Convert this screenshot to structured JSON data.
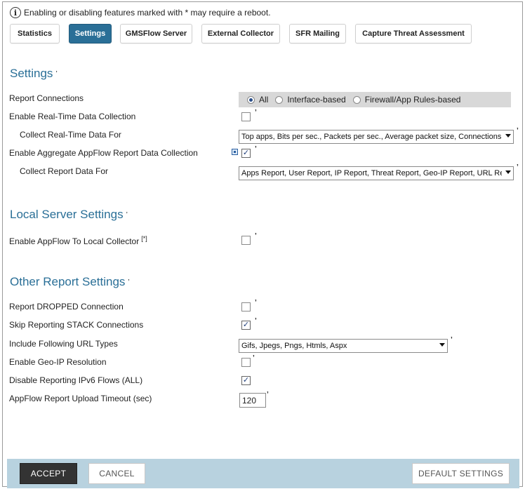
{
  "notice": {
    "icon": "info-icon",
    "text": "Enabling or disabling features marked with * may require a reboot."
  },
  "tabs": [
    {
      "label": "Statistics",
      "active": false
    },
    {
      "label": "Settings",
      "active": true
    },
    {
      "label": "GMSFlow Server",
      "active": false
    },
    {
      "label": "External Collector",
      "active": false
    },
    {
      "label": "SFR Mailing",
      "active": false
    },
    {
      "label": "Capture Threat Assessment",
      "active": false
    }
  ],
  "settings": {
    "title": "Settings",
    "report_connections": {
      "label": "Report Connections",
      "options": [
        "All",
        "Interface-based",
        "Firewall/App Rules-based"
      ],
      "selected": "All"
    },
    "realtime": {
      "label": "Enable Real-Time Data Collection",
      "checked": false
    },
    "realtime_for": {
      "label": "Collect Real-Time Data For",
      "value": "Top apps, Bits per sec., Packets per sec., Average packet size, Connections per"
    },
    "aggregate": {
      "label": "Enable Aggregate AppFlow Report Data Collection",
      "checked": true
    },
    "report_for": {
      "label": "Collect Report Data For",
      "value": "Apps Report, User Report, IP Report, Threat Report, Geo-IP Report, URL Report"
    }
  },
  "local": {
    "title": "Local Server Settings",
    "enable_local": {
      "label": "Enable AppFlow To Local Collector",
      "marker": "[*]",
      "checked": false
    }
  },
  "other": {
    "title": "Other Report Settings",
    "dropped": {
      "label": "Report DROPPED Connection",
      "checked": false
    },
    "stack": {
      "label": "Skip Reporting STACK Connections",
      "checked": true
    },
    "url_types": {
      "label": "Include Following URL Types",
      "value": "Gifs, Jpegs, Pngs, Htmls, Aspx"
    },
    "geoip": {
      "label": "Enable Geo-IP Resolution",
      "checked": false
    },
    "ipv6": {
      "label": "Disable Reporting IPv6 Flows (ALL)",
      "checked": true
    },
    "timeout": {
      "label": "AppFlow Report Upload Timeout (sec)",
      "value": "120"
    }
  },
  "footer": {
    "accept": "ACCEPT",
    "cancel": "CANCEL",
    "defaults": "DEFAULT SETTINGS"
  },
  "colors": {
    "accent": "#2a6f97",
    "footer_bg": "#b8d2df",
    "primary_button": "#333333"
  }
}
